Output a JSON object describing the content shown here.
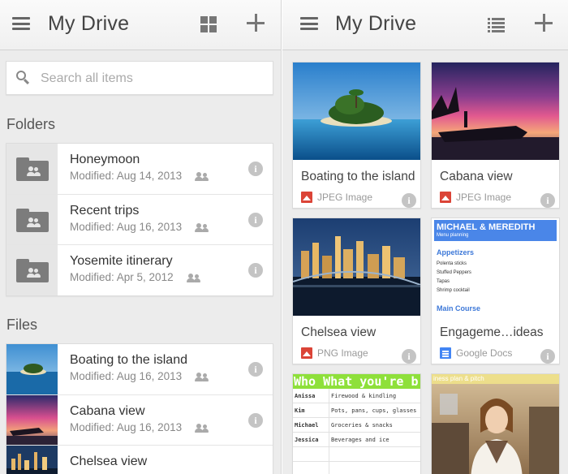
{
  "left_pane": {
    "title": "My Drive",
    "search_placeholder": "Search all items",
    "folders_label": "Folders",
    "files_label": "Files",
    "folders": [
      {
        "name": "Honeymoon",
        "modified": "Modified: Aug 14, 2013",
        "shared": true
      },
      {
        "name": "Recent trips",
        "modified": "Modified: Aug 16, 2013",
        "shared": true
      },
      {
        "name": "Yosemite itinerary",
        "modified": "Modified: Apr 5, 2012",
        "shared": true
      }
    ],
    "files": [
      {
        "name": "Boating to the island",
        "modified": "Modified: Aug 16, 2013",
        "shared": true
      },
      {
        "name": "Cabana view",
        "modified": "Modified: Aug 16, 2013",
        "shared": true
      },
      {
        "name": "Chelsea view",
        "modified": "",
        "shared": false
      }
    ]
  },
  "right_pane": {
    "title": "My Drive",
    "tiles": [
      {
        "name": "Boating to the island",
        "type": "JPEG Image",
        "icon": "image-file-icon"
      },
      {
        "name": "Cabana view",
        "type": "JPEG Image",
        "icon": "image-file-icon"
      },
      {
        "name": "Chelsea view",
        "type": "PNG Image",
        "icon": "image-file-icon"
      },
      {
        "name": "Engageme…ideas",
        "type": "Google Docs",
        "icon": "google-docs-icon"
      }
    ],
    "doc_preview": {
      "title": "MICHAEL & MEREDITH",
      "subtitle": "Menu planning",
      "heading1": "Appetizers",
      "items": [
        "Polenta sticks",
        "Stuffed Peppers",
        "Tapas",
        "Shrimp cocktail"
      ],
      "heading2": "Main Course"
    },
    "sheet_preview": {
      "header": "Who What you're b",
      "rows": [
        {
          "who": "Anissa",
          "what": "Firewood & kindling"
        },
        {
          "who": "Kim",
          "what": "Pots, pans, cups, glasses (paper)"
        },
        {
          "who": "Michael",
          "what": "Groceries & snacks"
        },
        {
          "who": "Jessica",
          "what": "Beverages and ice"
        }
      ]
    },
    "photo_preview_caption": "iness plan & pitch"
  },
  "colors": {
    "accent_red": "#db4437",
    "docs_blue": "#4285f4",
    "sheet_green": "#8ee03a"
  }
}
